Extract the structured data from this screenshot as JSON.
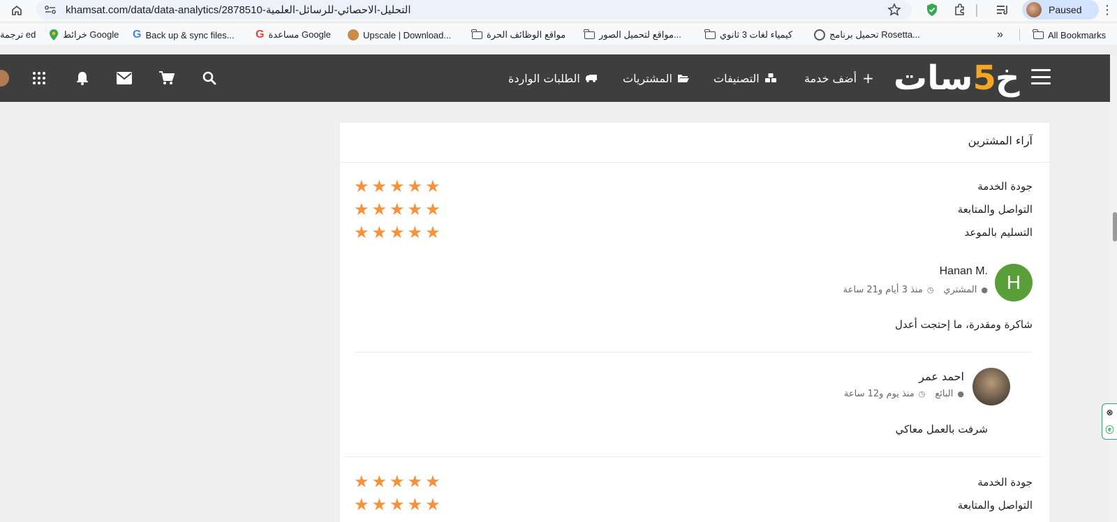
{
  "browser": {
    "url": "khamsat.com/data/data-analytics/2878510-التحليل-الاحصائي-للرسائل-العلمية",
    "profile_status": "Paused",
    "menu_glyph": "⋮"
  },
  "bookmarks": {
    "items": [
      "ترجمة ed",
      "خرائط Google",
      "Back up & sync files...",
      "مساعدة Google",
      "Upscale | Download...",
      "مواقع الوظائف الحرة",
      "مواقع لتحميل الصور...",
      "كيمياء لغات 3 ثانوي",
      "تحميل برنامج Rosetta...",
      "»",
      "All Bookmarks"
    ]
  },
  "nav": {
    "logo_a": "خ",
    "logo_five": "5",
    "logo_b": "سات",
    "add_service": "أضف خدمة",
    "categories": "التصنيفات",
    "purchases": "المشتريات",
    "incoming_orders": "الطلبات الواردة"
  },
  "reviews": {
    "title": "آراء المشترين",
    "criteria": [
      "جودة الخدمة",
      "التواصل والمتابعة",
      "التسليم بالموعد"
    ],
    "ratings": [
      5,
      5,
      5
    ],
    "buyer": {
      "initial": "H",
      "name": "Hanan M.",
      "role": "المشتري",
      "time": "منذ 3 أيام و21 ساعة",
      "text": "شاكرة ومقدرة، ما إحتجت أعدل"
    },
    "seller": {
      "name": "احمد عمر",
      "role": "البائع",
      "time": "منذ يوم و12 ساعة",
      "text": "شرفت بالعمل معاكي"
    },
    "next_criteria": [
      "جودة الخدمة",
      "التواصل والمتابعة"
    ],
    "next_ratings": [
      5,
      5
    ]
  },
  "colors": {
    "star": "#f7923b",
    "nav_bg": "#3e3e3e",
    "avatar_green": "#5a9e3a",
    "logo_accent": "#f5a623"
  }
}
